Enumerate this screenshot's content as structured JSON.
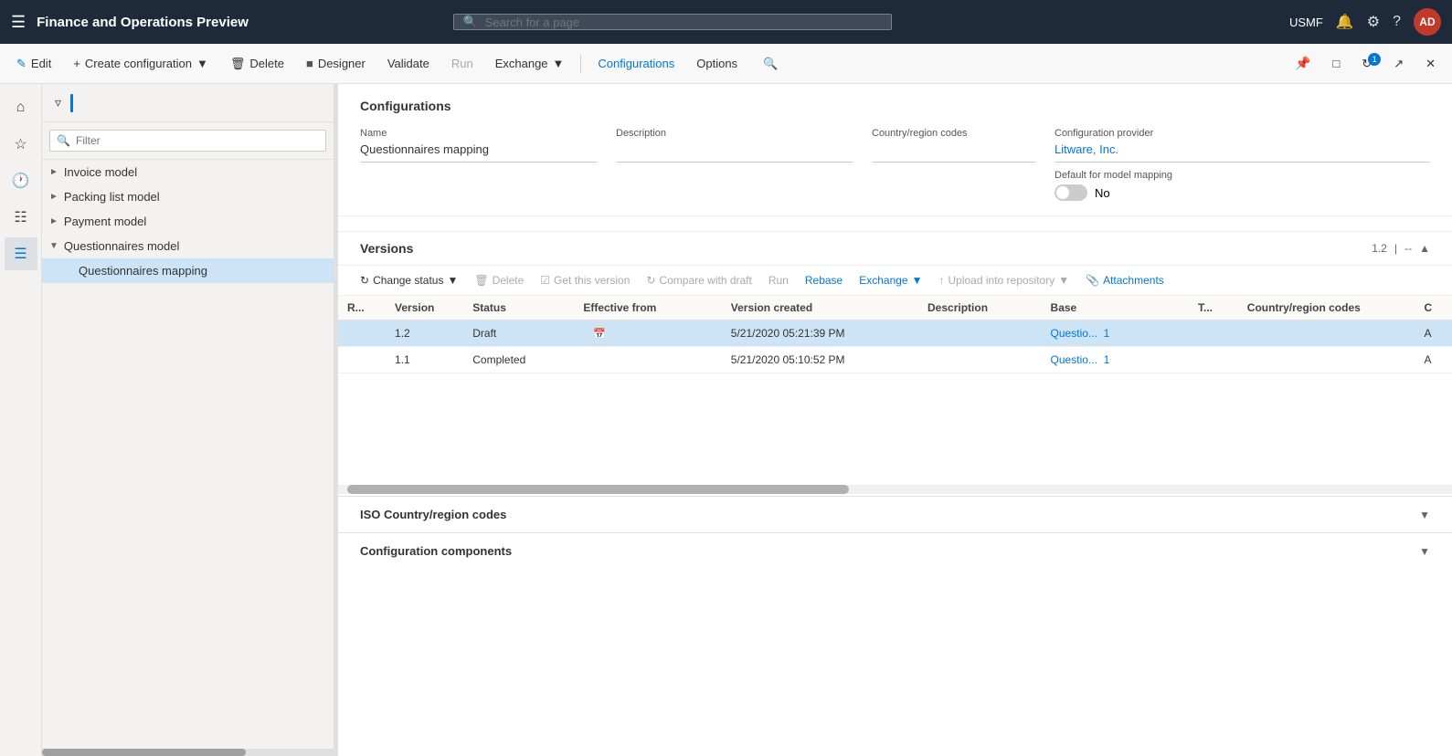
{
  "app": {
    "title": "Finance and Operations Preview",
    "search_placeholder": "Search for a page"
  },
  "topnav": {
    "username": "USMF",
    "avatar_initials": "AD",
    "notification_badge": "1"
  },
  "commandbar": {
    "edit_label": "Edit",
    "create_config_label": "Create configuration",
    "delete_label": "Delete",
    "designer_label": "Designer",
    "validate_label": "Validate",
    "run_label": "Run",
    "exchange_label": "Exchange",
    "configurations_label": "Configurations",
    "options_label": "Options"
  },
  "tree": {
    "filter_placeholder": "Filter",
    "items": [
      {
        "id": "invoice-model",
        "label": "Invoice model",
        "expanded": false,
        "level": 0
      },
      {
        "id": "packing-list-model",
        "label": "Packing list model",
        "expanded": false,
        "level": 0
      },
      {
        "id": "payment-model",
        "label": "Payment model",
        "expanded": false,
        "level": 0
      },
      {
        "id": "questionnaires-model",
        "label": "Questionnaires model",
        "expanded": true,
        "level": 0
      },
      {
        "id": "questionnaires-mapping",
        "label": "Questionnaires mapping",
        "expanded": false,
        "level": 1,
        "selected": true
      }
    ]
  },
  "config": {
    "section_title": "Configurations",
    "name_label": "Name",
    "name_value": "Questionnaires mapping",
    "description_label": "Description",
    "description_value": "",
    "country_region_label": "Country/region codes",
    "country_region_value": "",
    "provider_label": "Configuration provider",
    "provider_value": "Litware, Inc.",
    "default_mapping_label": "Default for model mapping",
    "default_mapping_value": "No"
  },
  "versions": {
    "section_title": "Versions",
    "version_display": "1.2",
    "toolbar": {
      "change_status_label": "Change status",
      "delete_label": "Delete",
      "get_this_version_label": "Get this version",
      "compare_with_draft_label": "Compare with draft",
      "run_label": "Run",
      "rebase_label": "Rebase",
      "exchange_label": "Exchange",
      "upload_into_repo_label": "Upload into repository",
      "attachments_label": "Attachments"
    },
    "columns": {
      "r": "R...",
      "version": "Version",
      "status": "Status",
      "effective_from": "Effective from",
      "version_created": "Version created",
      "description": "Description",
      "base": "Base",
      "t": "T...",
      "country_region": "Country/region codes",
      "c": "C"
    },
    "rows": [
      {
        "r": "",
        "version": "1.2",
        "status": "Draft",
        "effective_from": "",
        "version_created": "5/21/2020 05:21:39 PM",
        "description": "",
        "base": "Questio...",
        "base_num": "1",
        "t": "",
        "country_region": "",
        "c": "A",
        "selected": true
      },
      {
        "r": "",
        "version": "1.1",
        "status": "Completed",
        "effective_from": "",
        "version_created": "5/21/2020 05:10:52 PM",
        "description": "",
        "base": "Questio...",
        "base_num": "1",
        "t": "",
        "country_region": "",
        "c": "A",
        "selected": false
      }
    ]
  },
  "accordion": {
    "iso_title": "ISO Country/region codes",
    "components_title": "Configuration components"
  }
}
